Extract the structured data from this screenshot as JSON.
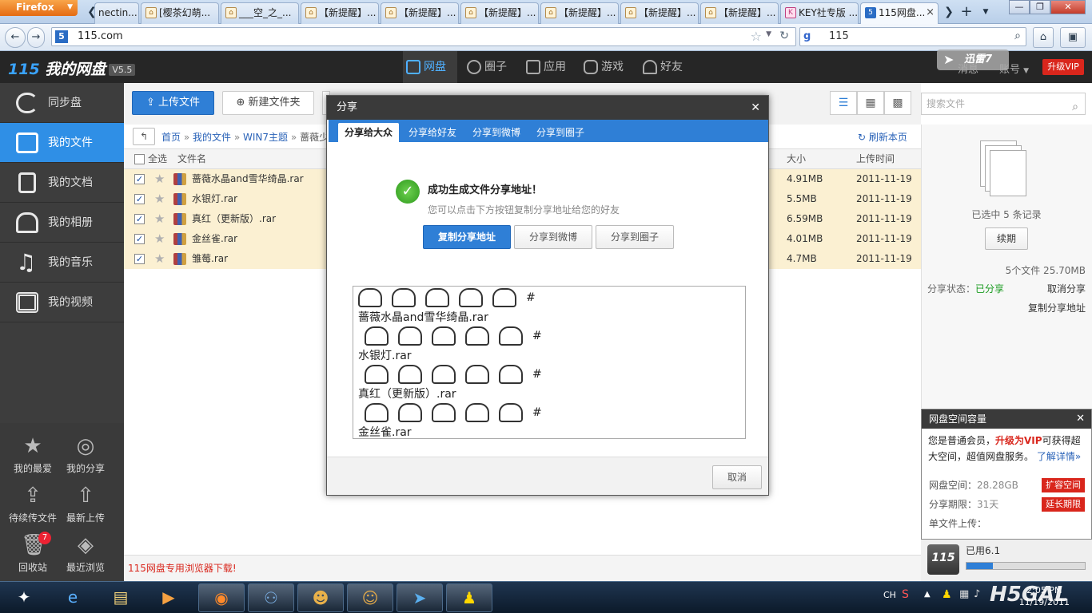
{
  "browser": {
    "menu_button": "Firefox",
    "tabs": [
      {
        "label": "nectin..."
      },
      {
        "label": "[樱茶幻萌..."
      },
      {
        "label": "___空_之_..."
      },
      {
        "label": "【新提醒】..."
      },
      {
        "label": "【新提醒】..."
      },
      {
        "label": "【新提醒】..."
      },
      {
        "label": "【新提醒】..."
      },
      {
        "label": "【新提醒】..."
      },
      {
        "label": "【新提醒】..."
      },
      {
        "label": "KEY社专版 ..."
      },
      {
        "label": "115网盘..."
      }
    ],
    "url": "115.com",
    "search_value": "115"
  },
  "app": {
    "logo_num": "115",
    "logo_text": "我的网盘",
    "version": "V5.5",
    "nav": [
      {
        "label": "网盘"
      },
      {
        "label": "圈子"
      },
      {
        "label": "应用"
      },
      {
        "label": "游戏"
      },
      {
        "label": "好友"
      }
    ],
    "header_msg": "消息",
    "header_account": "账号",
    "vip_button": "升级VIP",
    "xunlei": "迅雷7"
  },
  "sidebar": {
    "items": [
      {
        "label": "同步盘"
      },
      {
        "label": "我的文件"
      },
      {
        "label": "我的文档"
      },
      {
        "label": "我的相册"
      },
      {
        "label": "我的音乐"
      },
      {
        "label": "我的视频"
      }
    ],
    "bottom": [
      {
        "label": "我的最爱"
      },
      {
        "label": "我的分享"
      },
      {
        "label": "待续传文件"
      },
      {
        "label": "最新上传"
      },
      {
        "label": "回收站",
        "badge": "7"
      },
      {
        "label": "最近浏览"
      }
    ]
  },
  "toolbar": {
    "upload": "上传文件",
    "new_folder": "新建文件夹",
    "search_placeholder": "搜索文件"
  },
  "breadcrumb": {
    "home": "首页",
    "sep": "»",
    "my_files": "我的文件",
    "theme": "WIN7主题",
    "current": "蔷薇少",
    "refresh": "刷新本页"
  },
  "table": {
    "select_all": "全选",
    "col_name": "文件名",
    "col_size": "大小",
    "col_time": "上传时间",
    "rows": [
      {
        "name": "蔷薇水晶and雪华绮晶.rar",
        "size": "4.91MB",
        "time": "2011-11-19"
      },
      {
        "name": "水银灯.rar",
        "size": "5.5MB",
        "time": "2011-11-19"
      },
      {
        "name": "真红（更新版）.rar",
        "size": "6.59MB",
        "time": "2011-11-19"
      },
      {
        "name": "金丝雀.rar",
        "size": "4.01MB",
        "time": "2011-11-19"
      },
      {
        "name": "雏莓.rar",
        "size": "4.7MB",
        "time": "2011-11-19"
      }
    ]
  },
  "footer_link": "115网盘专用浏览器下载!",
  "right_panel": {
    "selected": "已选中 5 条记录",
    "renew": "续期",
    "file_stat": "5个文件 25.70MB",
    "share_label": "分享状态：",
    "share_value": "已分享",
    "cancel_share": "取消分享",
    "copy_addr": "复制分享地址"
  },
  "capacity": {
    "title": "网盘空间容量",
    "msg_a": "您是普通会员，",
    "msg_b": "升级为VIP",
    "msg_c": "可获得超大空间，超值网盘服务。",
    "msg_link": "了解详情»",
    "space_label": "网盘空间：",
    "space_value": "28.28GB",
    "space_btn": "扩容空间",
    "period_label": "分享期限：",
    "period_value": "31天",
    "period_btn": "延长期限",
    "single_label": "单文件上传：",
    "used_text": "已用6.1",
    "used_frac": 0.22
  },
  "modal": {
    "title": "分享",
    "tabs": [
      {
        "label": "分享给大众"
      },
      {
        "label": "分享给好友"
      },
      {
        "label": "分享到微博"
      },
      {
        "label": "分享到圈子"
      }
    ],
    "success_title": "成功生成文件分享地址！",
    "success_sub": "您可以点击下方按钮复制分享地址给您的好友",
    "btn_copy": "复制分享地址",
    "btn_weibo": "分享到微博",
    "btn_circle": "分享到圈子",
    "text_lines": [
      "#",
      "蔷薇水晶and雪华绮晶.rar",
      "#",
      "水银灯.rar",
      "#",
      "真红（更新版）.rar",
      "#",
      "金丝雀.rar"
    ],
    "cancel": "取消"
  },
  "taskbar": {
    "lang": "CH",
    "time": "2:05 PM",
    "date": "11/19/2011",
    "watermark": "H5GAL"
  }
}
